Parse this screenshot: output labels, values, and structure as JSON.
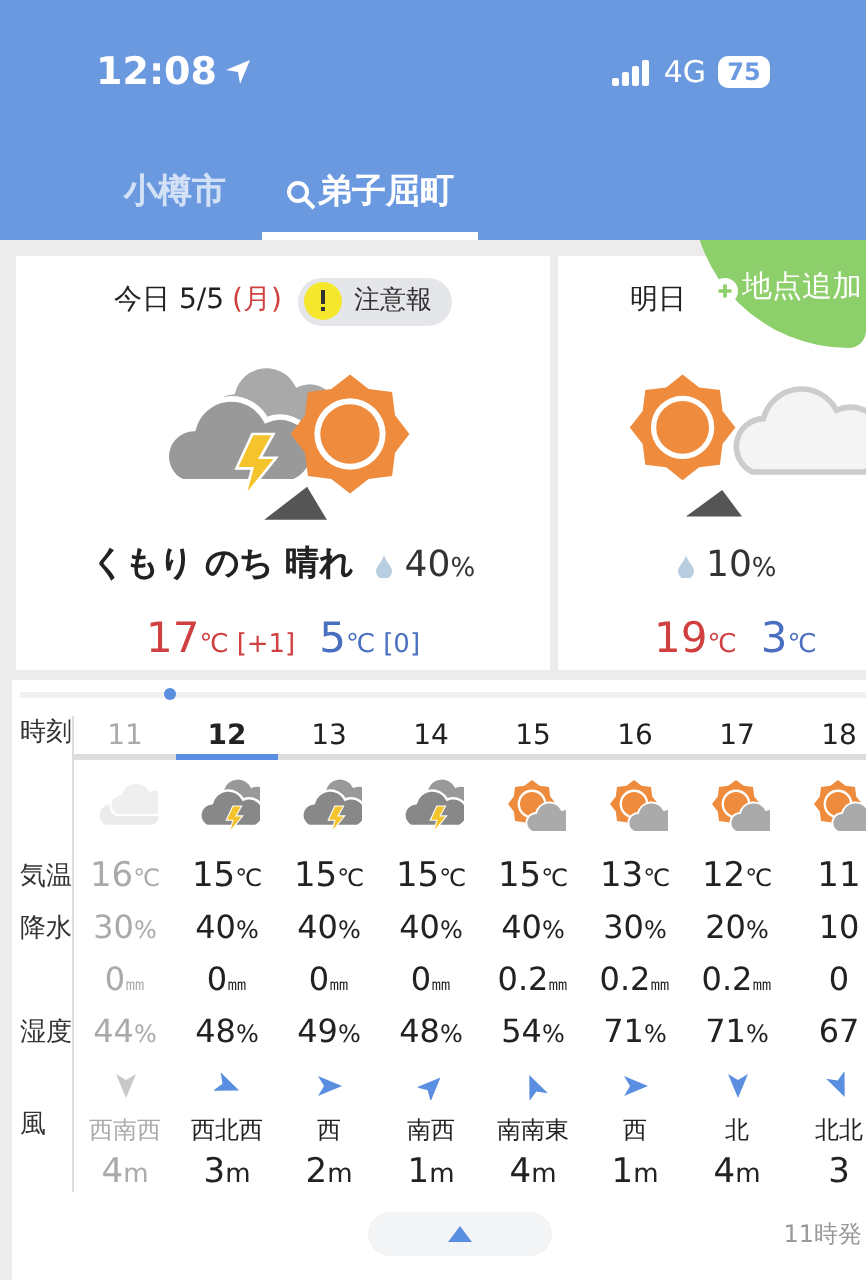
{
  "status_bar": {
    "time": "12:08",
    "network": "4G",
    "battery": "75"
  },
  "tabs": [
    {
      "label": "小樽市",
      "selected": false,
      "search": false
    },
    {
      "label": "弟子屈町",
      "selected": true,
      "search": true
    }
  ],
  "add_location": {
    "label": "地点追加"
  },
  "days": [
    {
      "day_label": "今日",
      "date": "5/5",
      "weekday": "(月)",
      "alert": "注意報",
      "kind": "thunder_then_sun",
      "summary": "くもり のち 晴れ",
      "precip": "40%",
      "high": "17℃",
      "high_diff": "[+1]",
      "low": "5℃",
      "low_diff": "[0]"
    },
    {
      "day_label": "明日",
      "kind": "sun_then_cloud",
      "precip": "10%",
      "high": "19℃",
      "low": "3℃"
    }
  ],
  "hourly": {
    "row_labels": [
      "時刻",
      "気温",
      "降水",
      "湿度",
      "風"
    ],
    "hours": [
      {
        "hour": "11",
        "selected": false,
        "past": true,
        "kind": "cloudy",
        "temp": "16℃",
        "precip": "30%",
        "rain": "0㎜",
        "humidity": "44%",
        "wind_arrow": {
          "kind": "S"
        },
        "wind_dir": "西南西",
        "wind_speed": "4m"
      },
      {
        "hour": "12",
        "selected": true,
        "past": false,
        "kind": "thunder",
        "temp": "15℃",
        "precip": "40%",
        "rain": "0㎜",
        "humidity": "48%",
        "wind_arrow": {
          "kind": "ESE"
        },
        "wind_dir": "西北西",
        "wind_speed": "3m"
      },
      {
        "hour": "13",
        "selected": false,
        "past": false,
        "kind": "thunder",
        "temp": "15℃",
        "precip": "40%",
        "rain": "0㎜",
        "humidity": "49%",
        "wind_arrow": {
          "kind": "E"
        },
        "wind_dir": "西",
        "wind_speed": "2m"
      },
      {
        "hour": "14",
        "selected": false,
        "past": false,
        "kind": "thunder",
        "temp": "15℃",
        "precip": "40%",
        "rain": "0㎜",
        "humidity": "48%",
        "wind_arrow": {
          "kind": "NE"
        },
        "wind_dir": "南西",
        "wind_speed": "1m"
      },
      {
        "hour": "15",
        "selected": false,
        "past": false,
        "kind": "sun_cloud",
        "temp": "15℃",
        "precip": "40%",
        "rain": "0.2㎜",
        "humidity": "54%",
        "wind_arrow": {
          "kind": "NNW"
        },
        "wind_dir": "南南東",
        "wind_speed": "4m"
      },
      {
        "hour": "16",
        "selected": false,
        "past": false,
        "kind": "sun_cloud",
        "temp": "13℃",
        "precip": "30%",
        "rain": "0.2㎜",
        "humidity": "71%",
        "wind_arrow": {
          "kind": "E"
        },
        "wind_dir": "西",
        "wind_speed": "1m"
      },
      {
        "hour": "17",
        "selected": false,
        "past": false,
        "kind": "sun_cloud",
        "temp": "12℃",
        "precip": "20%",
        "rain": "0.2㎜",
        "humidity": "71%",
        "wind_arrow": {
          "kind": "S"
        },
        "wind_dir": "北",
        "wind_speed": "4m"
      },
      {
        "hour": "18",
        "selected": false,
        "past": false,
        "kind": "sun_cloud",
        "temp": "11",
        "precip": "10",
        "rain": "0",
        "humidity": "67",
        "wind_arrow": {
          "kind": "SSE"
        },
        "wind_dir": "北北",
        "wind_speed": "3"
      }
    ]
  },
  "issued": "11時発"
}
